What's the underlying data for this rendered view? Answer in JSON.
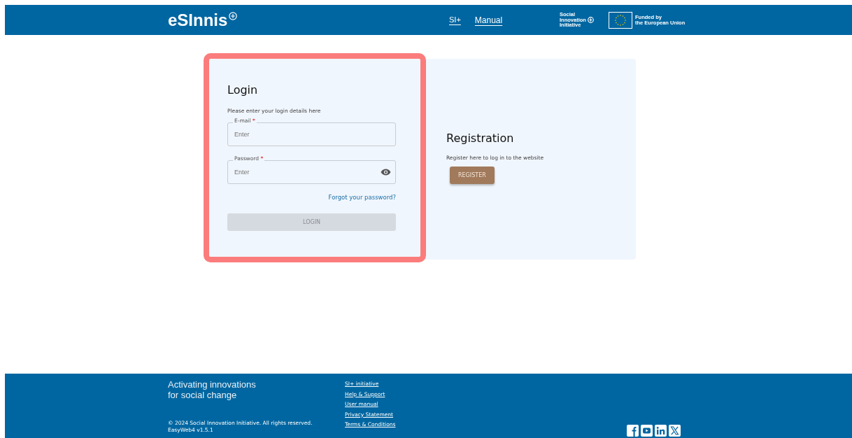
{
  "header": {
    "logo": "eSInnis",
    "nav": [
      {
        "label": "SI+"
      },
      {
        "label": "Manual"
      }
    ],
    "partner": {
      "name_lines": [
        "Social",
        "Innovation",
        "Initiative"
      ]
    },
    "funding": {
      "lines": [
        "Funded by",
        "the European Union"
      ]
    }
  },
  "login": {
    "highlighted": true,
    "title": "Login",
    "subtitle": "Please enter your login details here",
    "fields": [
      {
        "label": "E-mail",
        "required_mark": "*",
        "placeholder": "Enter",
        "kind": "text"
      },
      {
        "label": "Password",
        "required_mark": "*",
        "placeholder": "Enter",
        "kind": "password"
      }
    ],
    "forgot_link": "Forgot your password?",
    "button": {
      "label": "LOGIN",
      "disabled": true
    }
  },
  "registration": {
    "title": "Registration",
    "subtitle": "Register here to log in to the website",
    "button": "REGISTER"
  },
  "footer": {
    "tagline_lines": [
      "Activating innovations",
      "for social change"
    ],
    "copyright": "© 2024 Social Innovation Initiative. All rights reserved.",
    "version": "EasyWeb4 v1.5.1",
    "links": [
      "SI+ initiative",
      "Help & Support",
      "User manual",
      "Privacy Statement",
      "Terms & Conditions"
    ]
  }
}
